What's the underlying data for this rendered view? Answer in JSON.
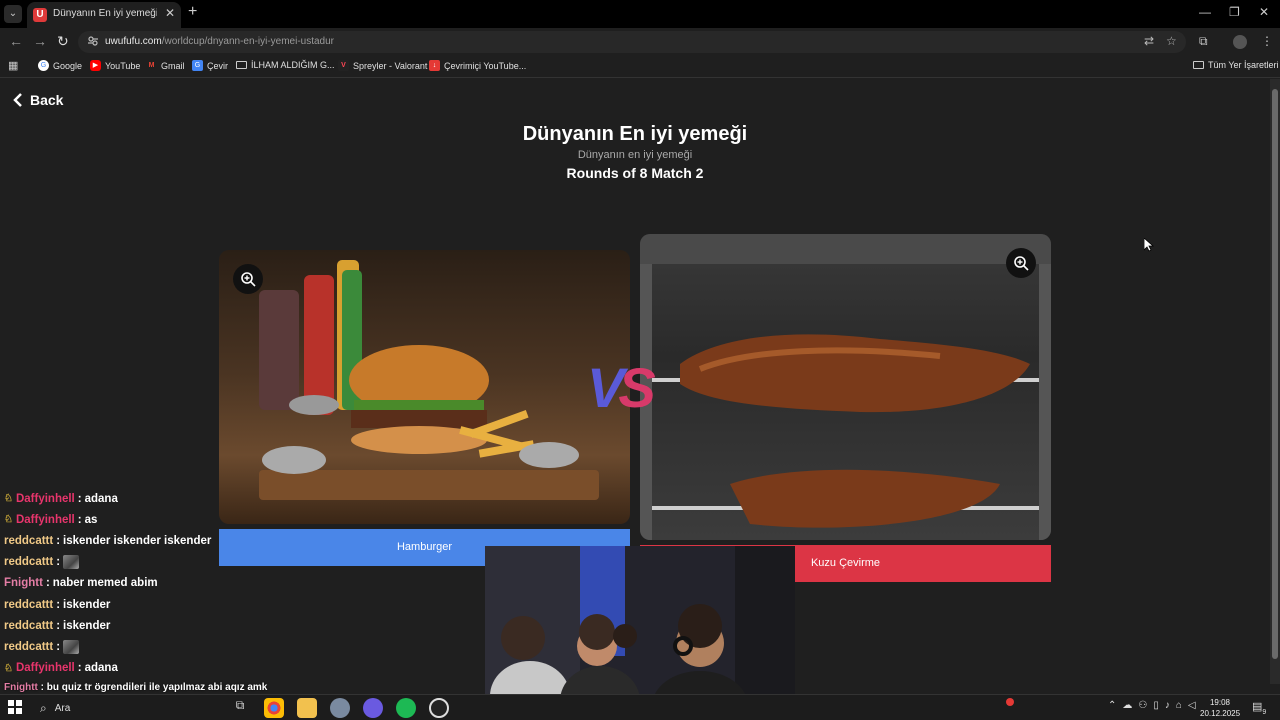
{
  "browser": {
    "tab_title": "Dünyanın En iyi yemeği | UwUFu",
    "tab_favicon_letter": "U",
    "url_domain": "uwufufu.com",
    "url_path": "/worldcup/dnyann-en-iyi-yemei-ustadur"
  },
  "bookmarks": [
    {
      "label": "Google",
      "icon": "google-icon",
      "color": "#ffffff"
    },
    {
      "label": "YouTube",
      "icon": "youtube-icon",
      "color": "#ff0000"
    },
    {
      "label": "Gmail",
      "icon": "gmail-icon",
      "color": "#ea4335"
    },
    {
      "label": "Çevir",
      "icon": "translate-icon",
      "color": "#4285f4"
    },
    {
      "label": "İLHAM ALDIĞIM G...",
      "icon": "folder-icon",
      "color": "#cccccc"
    },
    {
      "label": "Spreyler - Valorant",
      "icon": "valorant-icon",
      "color": "#ff4655"
    },
    {
      "label": "Çevrimiçi YouTube...",
      "icon": "download-icon",
      "color": "#e53935"
    }
  ],
  "all_bookmarks_label": "Tüm Yer İşaretleri",
  "page": {
    "back_label": "Back",
    "title": "Dünyanın En iyi yemeği",
    "subtitle": "Dünyanın en iyi yemeği",
    "rounds": "Rounds of 8 Match 2",
    "vs": "VS",
    "left_choice": {
      "label": "Hamburger",
      "color": "#4a86e8"
    },
    "right_choice": {
      "label": "Kuzu Çevirme",
      "color": "#dc3545"
    }
  },
  "chat": [
    {
      "user": "Daffyinhell",
      "msg": "adana",
      "color": "#e8356c",
      "badge": true
    },
    {
      "user": "Daffyinhell",
      "msg": "as",
      "color": "#e8356c",
      "badge": true
    },
    {
      "user": "reddcattt",
      "msg": "iskender iskender iskender",
      "color": "#f0c987",
      "badge": false
    },
    {
      "user": "reddcattt",
      "msg": "",
      "color": "#f0c987",
      "badge": false,
      "emote": true
    },
    {
      "user": "Fnightt",
      "msg": "naber memed abim",
      "color": "#e57ea6",
      "badge": false
    },
    {
      "user": "reddcattt",
      "msg": "iskender",
      "color": "#f0c987",
      "badge": false
    },
    {
      "user": "reddcattt",
      "msg": "iskender",
      "color": "#f0c987",
      "badge": false
    },
    {
      "user": "reddcattt",
      "msg": "",
      "color": "#f0c987",
      "badge": false,
      "emote": true
    },
    {
      "user": "Daffyinhell",
      "msg": "adana",
      "color": "#e8356c",
      "badge": true
    }
  ],
  "ticker": {
    "user": "Fnightt",
    "msg": "bu quiz tr ögrendileri ile yapılmaz abi aqız amk"
  },
  "taskbar": {
    "search_label": "Ara",
    "time": "19:08",
    "date": "20.12.2025",
    "notification_count": "9"
  }
}
